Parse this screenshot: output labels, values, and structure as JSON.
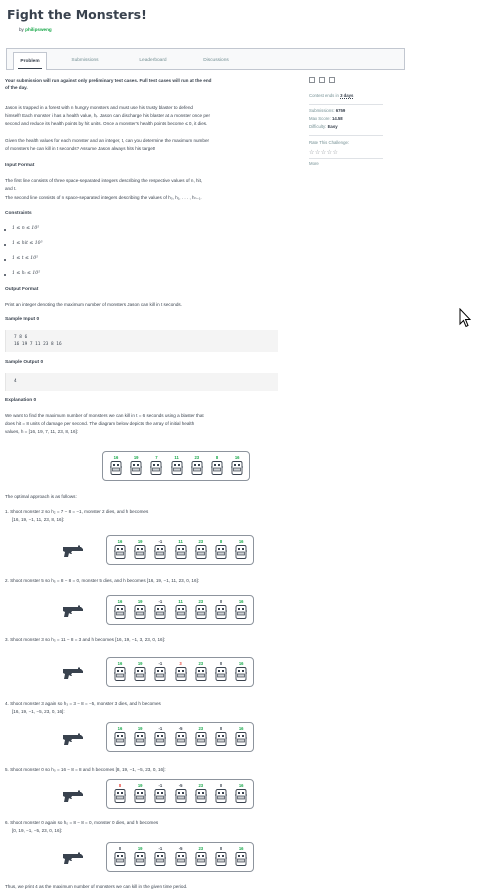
{
  "page": {
    "title": "Fight the Monsters!",
    "by_prefix": "by",
    "author": "philipsweng"
  },
  "tabs": [
    {
      "label": "Problem",
      "active": true
    },
    {
      "label": "Submissions",
      "active": false
    },
    {
      "label": "Leaderboard",
      "active": false
    },
    {
      "label": "Discussions",
      "active": false
    }
  ],
  "notice": {
    "line1": "Your submission will run against only preliminary test cases. Full test cases will run at the end",
    "line2": "of the day."
  },
  "statement": {
    "l1": "Jason is trapped in a forest with n hungry monsters and must use his trusty blaster to defend",
    "l2": "himself! Each monster i has a health value, hᵢ. Jason can discharge his blaster at a monster once per",
    "l3": "second and reduce its health points by hit units. Once a monster's health points become ≤ 0, it dies.",
    "l4": "Given the health values for each monster and an integer, t, can you determine the maximum number",
    "l5": "of monsters he can kill in t seconds? Assume Jason always hits his target!"
  },
  "input_format": {
    "heading": "Input Format",
    "l1": "The first line consists of three space-separated integers describing the respective values of n, hit,",
    "l2": "and t.",
    "l3": "The second line consists of n space-separated integers describing the values of h₀, h₁, . . . , hₙ₋₁."
  },
  "constraints": {
    "heading": "Constraints",
    "items": [
      "1 ≤ n ≤ 10⁵",
      "1 ≤ hit ≤ 10⁵",
      "1 ≤ t ≤ 10⁵",
      "1 ≤ hᵢ ≤ 10⁵"
    ]
  },
  "output_format": {
    "heading": "Output Format",
    "l1": "Print an integer denoting the maximum number of monsters Jason can kill in t seconds."
  },
  "sample_input": {
    "heading": "Sample Input 0",
    "line1": "7 8 6",
    "line2": "16 19 7 11 23 8 16"
  },
  "sample_output": {
    "heading": "Sample Output 0",
    "line1": "4"
  },
  "explanation": {
    "heading": "Explanation 0",
    "l1": "We want to find the maximum number of monsters we can kill in t = 6 seconds using a blaster that",
    "l2": "does hit = 8 units of damage per second. The diagram below depicts the array of initial health",
    "l3": "values, h = [16, 19, 7, 11, 23, 8, 16]:",
    "optimal": "The optimal approach is as follows:",
    "steps": [
      {
        "l1": "1. Shoot monster 2 so h₂ = 7 − 8 = −1, monster 2 dies, and h becomes",
        "l2": "[16, 19, −1, 11, 23, 8, 16]:"
      },
      {
        "l1": "2. Shoot monster 5 so h₅ = 8 − 8 = 0, monster 5 dies, and h becomes [16, 19, −1, 11, 23, 0, 16]:",
        "l2": ""
      },
      {
        "l1": "3. Shoot monster 3 so h₃ = 11 − 8 = 3 and h becomes [16, 19, −1, 3, 23, 0, 16]:",
        "l2": ""
      },
      {
        "l1": "4. Shoot monster 3 again so h₃ = 3 − 8 = −5, monster 3 dies, and h becomes",
        "l2": "[16, 19, −1, −5, 23, 0, 16]:"
      },
      {
        "l1": "5. Shoot monster 0 so h₀ = 16 − 8 = 8 and h becomes [8, 19, −1, −5, 23, 0, 16]:",
        "l2": ""
      },
      {
        "l1": "6. Shoot monster 0 again so h₀ = 8 − 8 = 0, monster 0 dies, and h becomes",
        "l2": "[0, 19, −1, −5, 23, 0, 16]:"
      }
    ],
    "conclusion": "Thus, we print 4 as the maximum number of monsters we can kill in the given time period."
  },
  "diagrams": [
    {
      "values": [
        "16",
        "19",
        "7",
        "11",
        "23",
        "8",
        "16"
      ],
      "colors": [
        "#1ba94c",
        "#1ba94c",
        "#1ba94c",
        "#1ba94c",
        "#1ba94c",
        "#1ba94c",
        "#1ba94c"
      ]
    },
    {
      "values": [
        "16",
        "19",
        "-1",
        "11",
        "23",
        "8",
        "16"
      ],
      "colors": [
        "#1ba94c",
        "#1ba94c",
        "#39424e",
        "#1ba94c",
        "#1ba94c",
        "#1ba94c",
        "#1ba94c"
      ]
    },
    {
      "values": [
        "16",
        "19",
        "-1",
        "11",
        "23",
        "0",
        "16"
      ],
      "colors": [
        "#1ba94c",
        "#1ba94c",
        "#39424e",
        "#1ba94c",
        "#1ba94c",
        "#39424e",
        "#1ba94c"
      ]
    },
    {
      "values": [
        "16",
        "19",
        "-1",
        "3",
        "23",
        "0",
        "16"
      ],
      "colors": [
        "#1ba94c",
        "#1ba94c",
        "#39424e",
        "#e8493f",
        "#1ba94c",
        "#39424e",
        "#1ba94c"
      ]
    },
    {
      "values": [
        "16",
        "19",
        "-1",
        "-5",
        "23",
        "0",
        "16"
      ],
      "colors": [
        "#1ba94c",
        "#1ba94c",
        "#39424e",
        "#39424e",
        "#1ba94c",
        "#39424e",
        "#1ba94c"
      ]
    },
    {
      "values": [
        "8",
        "19",
        "-1",
        "-5",
        "23",
        "0",
        "16"
      ],
      "colors": [
        "#e8493f",
        "#1ba94c",
        "#39424e",
        "#39424e",
        "#1ba94c",
        "#39424e",
        "#1ba94c"
      ]
    },
    {
      "values": [
        "0",
        "19",
        "-1",
        "-5",
        "23",
        "0",
        "16"
      ],
      "colors": [
        "#39424e",
        "#1ba94c",
        "#39424e",
        "#39424e",
        "#1ba94c",
        "#39424e",
        "#1ba94c"
      ]
    }
  ],
  "sidebar": {
    "contest_ends_prefix": "Contest ends in",
    "contest_ends_value": "3 days",
    "submissions_label": "Submissions:",
    "submissions_value": "6759",
    "max_score_label": "Max Score:",
    "max_score_value": "14.58",
    "difficulty_label": "Difficulty:",
    "difficulty_value": "Easy",
    "rate_label": "Rate This Challenge:",
    "stars": "☆☆☆☆☆",
    "more": "More"
  },
  "colors": {
    "accent_green": "#1ba94c",
    "text_dark": "#39424e",
    "red": "#e8493f"
  }
}
